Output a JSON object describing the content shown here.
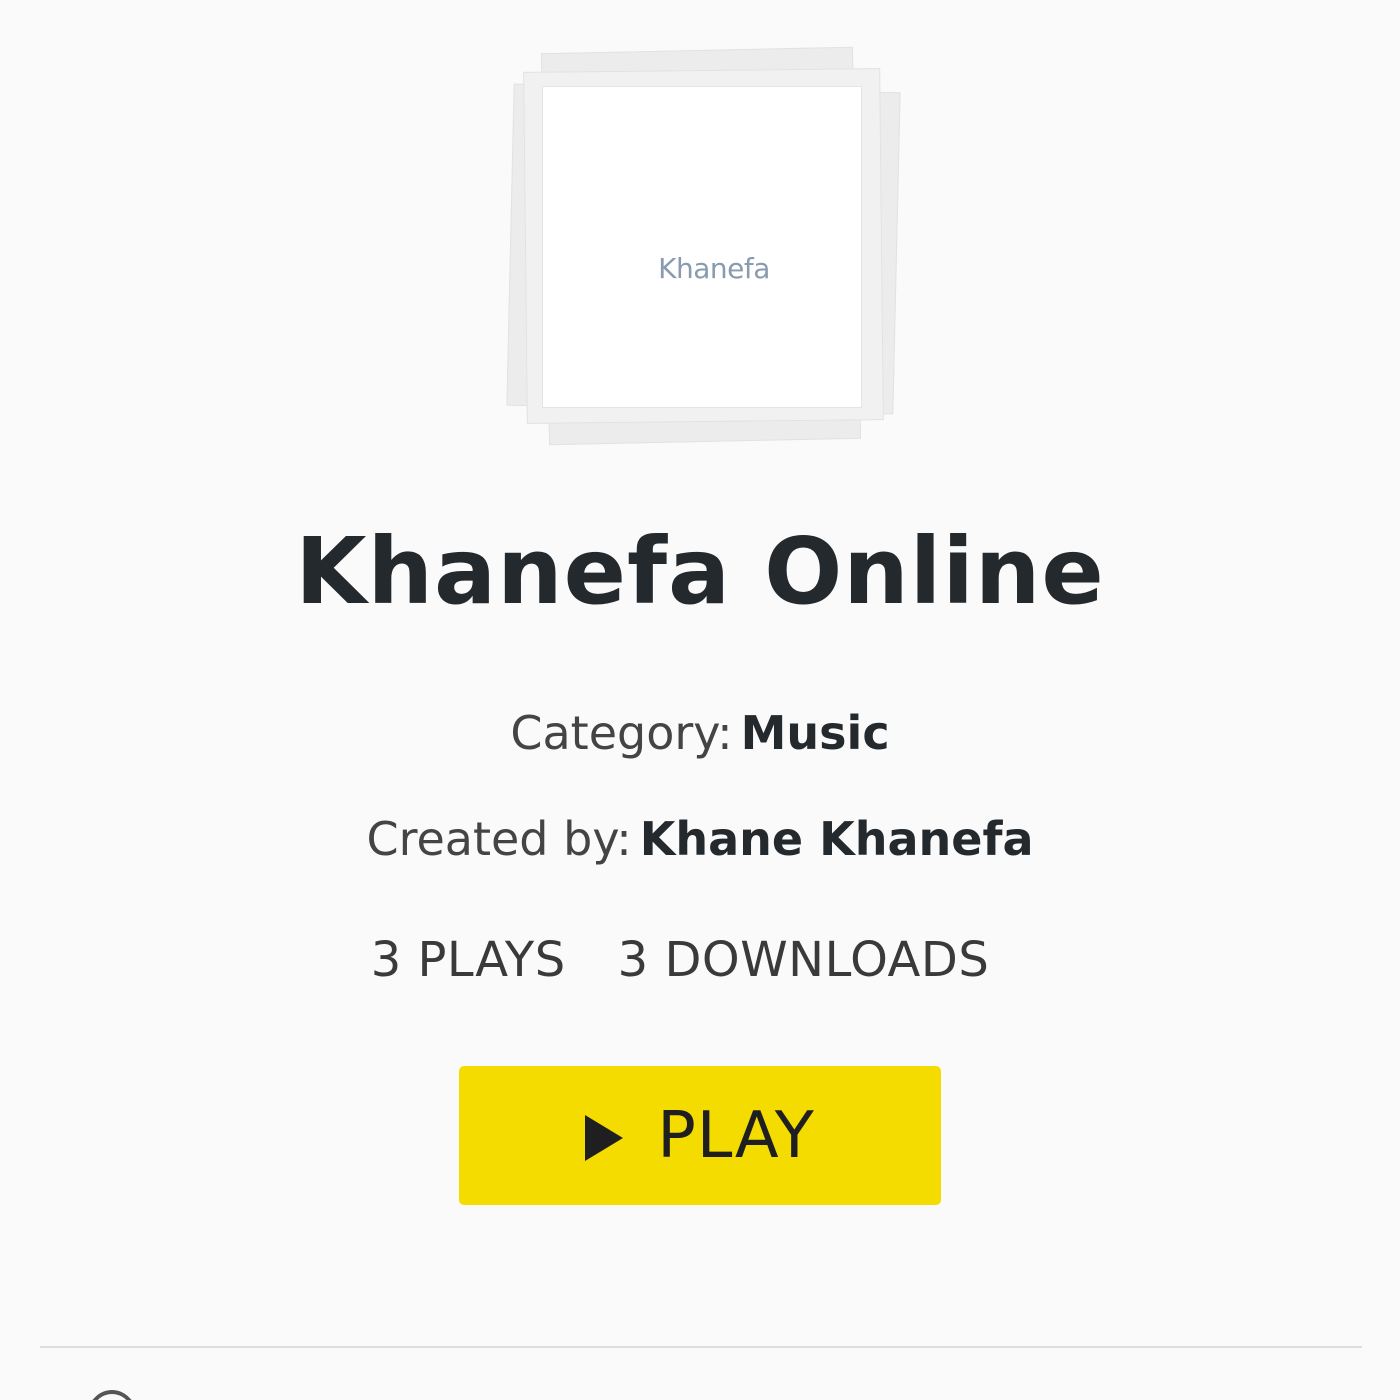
{
  "cover": {
    "text": "Khanefa"
  },
  "title": "Khanefa Online",
  "meta": {
    "category_label": "Category:",
    "category_value": "Music",
    "creator_label": "Created by:",
    "creator_value": "Khane Khanefa"
  },
  "stats": {
    "plays": "3 PLAYS",
    "downloads": "3 DOWNLOADS"
  },
  "play_button": {
    "label": "PLAY",
    "icon": "play-icon",
    "color": "#f4dc00"
  }
}
